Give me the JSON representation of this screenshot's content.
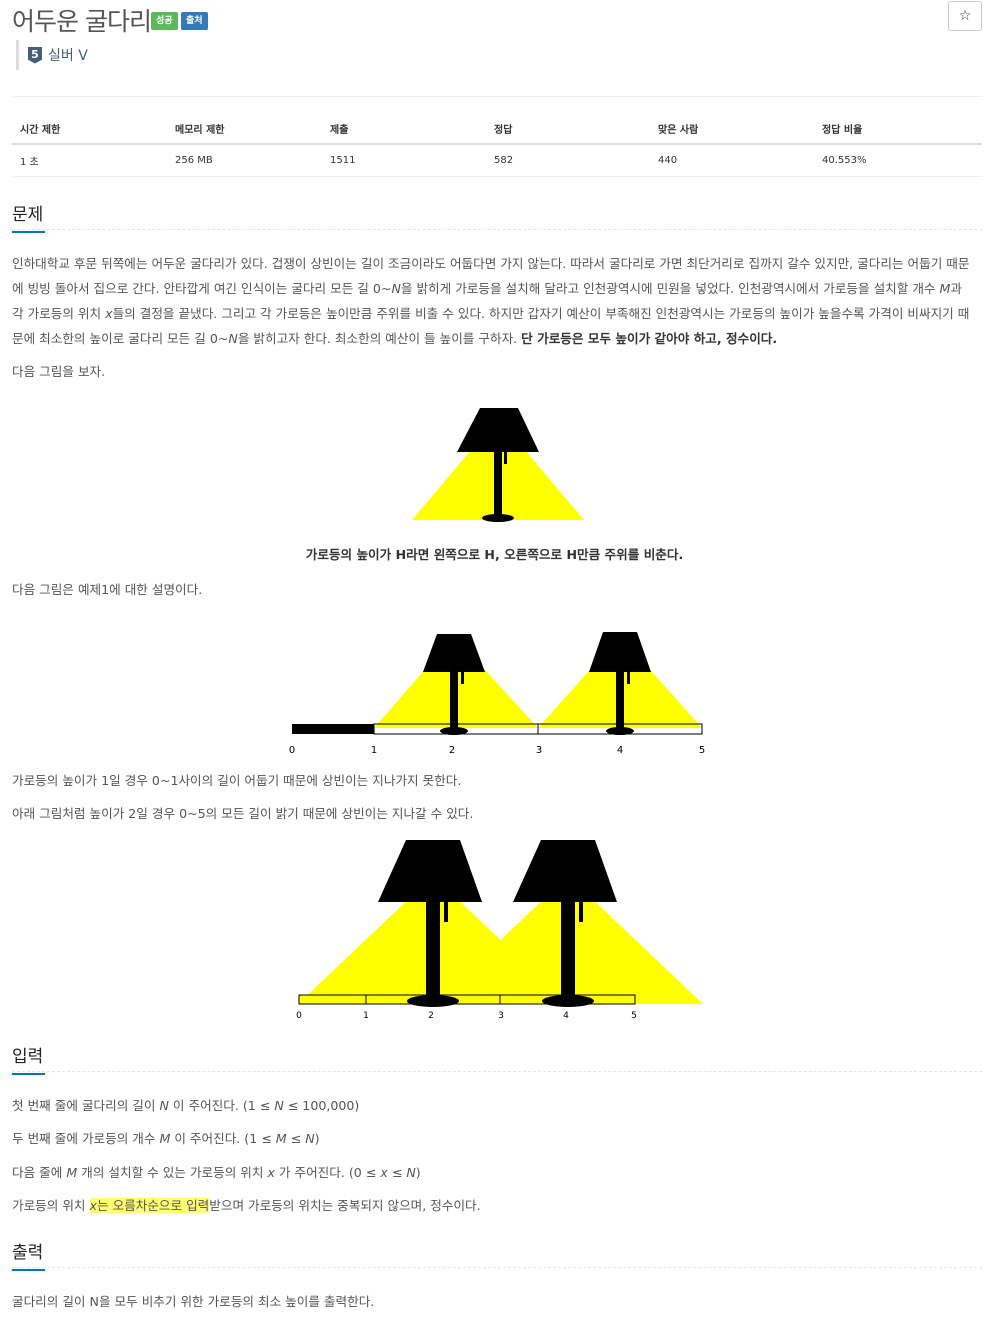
{
  "problem": {
    "title": "어두운 굴다리",
    "badges": [
      "성공",
      "출처"
    ],
    "star_icon": "☆",
    "tier": {
      "number": "5",
      "label": "실버 V"
    }
  },
  "info_table": {
    "headers": [
      "시간 제한",
      "메모리 제한",
      "제출",
      "정답",
      "맞은 사람",
      "정답 비율"
    ],
    "values": [
      "1 초",
      "256 MB",
      "1511",
      "582",
      "440",
      "40.553%"
    ]
  },
  "sections": {
    "problem_title": "문제",
    "input_title": "입력",
    "output_title": "출력"
  },
  "description": {
    "p1_a": "인하대학교 후문 뒤쪽에는 어두운 굴다리가 있다. 겁쟁이 상빈이는 길이 조금이라도 어둡다면 가지 않는다. 따라서 굴다리로 가면 최단거리로 집까지 갈수 있지만, 굴다리는 어둡기 때문에 빙빙 돌아서 집으로 간다. 안타깝게 여긴 인식이는 굴다리 모든 길 0~",
    "p1_N1": "N",
    "p1_b": "을 밝히게 가로등을 설치해 달라고 인천광역시에 민원을 넣었다. 인천광역시에서 가로등을 설치할 개수 ",
    "p1_M": "M",
    "p1_c": "과 각 가로등의 위치 ",
    "p1_x": "x",
    "p1_d": "들의 결정을 끝냈다. 그리고 각 가로등은 높이만큼 주위를 비출 수 있다. 하지만 갑자기 예산이 부족해진 인천광역시는 가로등의 높이가 높을수록 가격이 비싸지기 때문에 최소한의 높이로 굴다리 모든 길 0~",
    "p1_N2": "N",
    "p1_e": "을 밝히고자 한다. 최소한의 예산이 들 높이를 구하자. ",
    "p1_bold": "단 가로등은 모두 높이가 같아야 하고, 정수이다.",
    "p2": "다음 그림을 보자.",
    "caption": "가로등의 높이가 H라면 왼쪽으로 H, 오른쪽으로 H만큼 주위를 비춘다.",
    "p3": "다음 그림은 예제1에 대한 설명이다.",
    "p4": "가로등의 높이가 1일 경우 0~1사이의 길이 어둡기 때문에 상빈이는 지나가지 못한다.",
    "p5": "아래 그림처럼 높이가 2일 경우 0~5의 모든 길이 밝기 때문에 상빈이는 지나갈 수 있다."
  },
  "figures": {
    "colors": {
      "light": "#ffff00",
      "lamp": "#000000",
      "road": "#000000"
    },
    "fig2_ticks": [
      "0",
      "1",
      "2",
      "3",
      "4",
      "5"
    ],
    "fig3_ticks": [
      "0",
      "1",
      "2",
      "3",
      "4",
      "5"
    ]
  },
  "input": {
    "l1_a": "첫 번째 줄에 굴다리의 길이 ",
    "l1_var": "N",
    "l1_b": " 이 주어진다. (1 ≤ ",
    "l1_var2": "N",
    "l1_c": " ≤ 100,000)",
    "l2_a": "두 번째 줄에 가로등의 개수 ",
    "l2_var": "M",
    "l2_b": " 이 주어진다. (1 ≤ ",
    "l2_var2": "M",
    "l2_c": " ≤ ",
    "l2_var3": "N",
    "l2_d": ")",
    "l3_a": "다음 줄에 ",
    "l3_var": "M",
    "l3_b": " 개의 설치할 수 있는 가로등의 위치 ",
    "l3_var2": "x",
    "l3_c": " 가 주어진다. (0 ≤ ",
    "l3_var3": "x",
    "l3_d": " ≤ ",
    "l3_var4": "N",
    "l3_e": ")",
    "l4_a": "가로등의 위치 ",
    "l4_hl_var": "x",
    "l4_hl": "는 오름차순으로 입력",
    "l4_b": "받으며 가로등의 위치는 중복되지 않으며, 정수이다."
  },
  "output": {
    "l1": "굴다리의 길이 N을 모두 비추기 위한 가로등의 최소 높이를 출력한다."
  }
}
